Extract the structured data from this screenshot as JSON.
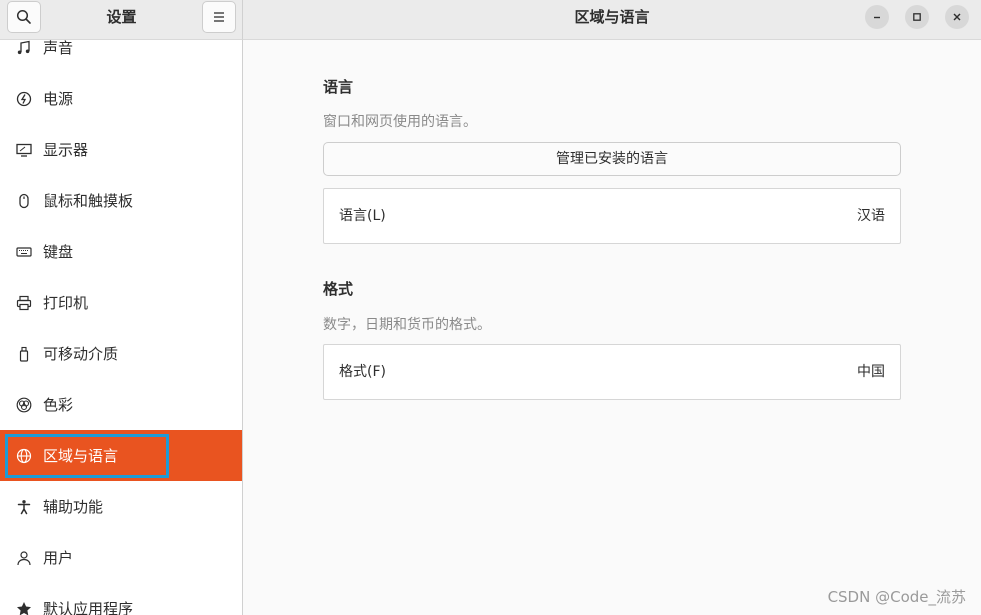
{
  "sidebar": {
    "title": "设置",
    "items": [
      {
        "label": "声音",
        "icon": "music-note-icon"
      },
      {
        "label": "电源",
        "icon": "power-icon"
      },
      {
        "label": "显示器",
        "icon": "display-icon"
      },
      {
        "label": "鼠标和触摸板",
        "icon": "mouse-icon"
      },
      {
        "label": "键盘",
        "icon": "keyboard-icon"
      },
      {
        "label": "打印机",
        "icon": "printer-icon"
      },
      {
        "label": "可移动介质",
        "icon": "removable-media-icon"
      },
      {
        "label": "色彩",
        "icon": "color-icon"
      },
      {
        "label": "区域与语言",
        "icon": "globe-icon",
        "active": true
      },
      {
        "label": "辅助功能",
        "icon": "accessibility-icon"
      },
      {
        "label": "用户",
        "icon": "user-icon"
      },
      {
        "label": "默认应用程序",
        "icon": "star-icon"
      }
    ]
  },
  "header": {
    "title": "区域与语言"
  },
  "language_section": {
    "title": "语言",
    "description": "窗口和网页使用的语言。",
    "manage_button": "管理已安装的语言",
    "row_label": "语言(L)",
    "row_value": "汉语"
  },
  "format_section": {
    "title": "格式",
    "description": "数字，日期和货币的格式。",
    "row_label": "格式(F)",
    "row_value": "中国"
  },
  "watermark": "CSDN @Code_流苏",
  "colors": {
    "accent": "#e95420",
    "focus": "#1f9bd6"
  }
}
